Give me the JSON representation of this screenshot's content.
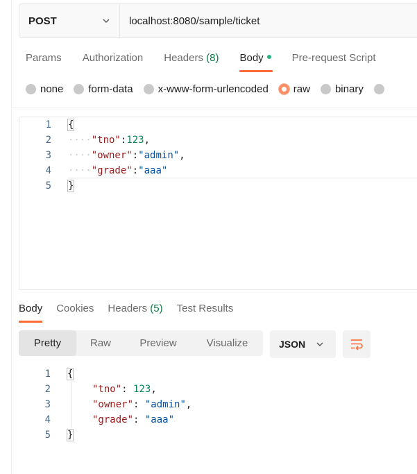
{
  "request": {
    "method": "POST",
    "url": "localhost:8080/sample/ticket"
  },
  "request_tabs": [
    {
      "label": "Params"
    },
    {
      "label": "Authorization"
    },
    {
      "label": "Headers",
      "count": "(8)"
    },
    {
      "label": "Body",
      "active": true
    },
    {
      "label": "Pre-request Script"
    }
  ],
  "body_types": [
    "none",
    "form-data",
    "x-www-form-urlencoded",
    "raw",
    "binary"
  ],
  "selected_body_type": "raw",
  "request_body": {
    "line_numbers": [
      "1",
      "2",
      "3",
      "4",
      "5"
    ],
    "brace_open": "{",
    "brace_close": "}",
    "indent": "····",
    "fields": [
      {
        "key": "\"tno\"",
        "sep": ":",
        "value": "123",
        "trail": ",",
        "type": "number"
      },
      {
        "key": "\"owner\"",
        "sep": ":",
        "value": "\"admin\"",
        "trail": ",",
        "type": "string"
      },
      {
        "key": "\"grade\"",
        "sep": ":",
        "value": "\"aaa\"",
        "trail": "",
        "type": "string"
      }
    ]
  },
  "response_tabs": [
    {
      "label": "Body",
      "active": true
    },
    {
      "label": "Cookies"
    },
    {
      "label": "Headers",
      "count": "(5)"
    },
    {
      "label": "Test Results"
    }
  ],
  "view_modes": [
    "Pretty",
    "Raw",
    "Preview",
    "Visualize"
  ],
  "selected_view": "Pretty",
  "format": "JSON",
  "response_body": {
    "line_numbers": [
      "1",
      "2",
      "3",
      "4",
      "5"
    ],
    "brace_open": "{",
    "brace_close": "}",
    "fields": [
      {
        "key": "\"tno\"",
        "sep": ": ",
        "value": "123",
        "trail": ",",
        "type": "number"
      },
      {
        "key": "\"owner\"",
        "sep": ": ",
        "value": "\"admin\"",
        "trail": ",",
        "type": "string"
      },
      {
        "key": "\"grade\"",
        "sep": ": ",
        "value": "\"aaa\"",
        "trail": "",
        "type": "string"
      }
    ]
  },
  "colors": {
    "accent": "#ff6c37",
    "key": "#9c1a1a",
    "number": "#098658",
    "string": "#0451a5",
    "count": "#0a7a44"
  },
  "icons": [
    "chevron-down-icon",
    "wrap-lines-icon"
  ]
}
